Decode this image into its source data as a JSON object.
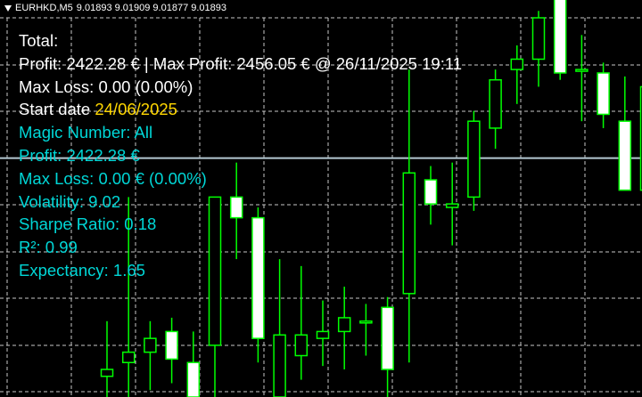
{
  "header": {
    "symbol": "EURHKD,M5",
    "quote": "9.01893 9.01909 9.01877 9.01893"
  },
  "stats": {
    "total_label": "Total:",
    "profit_line": "Profit: 2422.28 € | Max Profit: 2456.05 € @ 26/11/2025 19:11",
    "max_loss_line": "Max Loss: 0.00 (0.00%)",
    "start_label": "Start date",
    "start_value": "24/06/2025",
    "magic_line": "Magic Number: All",
    "magic_profit_line": "Profit: 2422.28 €",
    "magic_max_loss_line": "Max Loss: 0.00 € (0.00%)",
    "volatility_line": "Volatility: 9.02",
    "sharpe_line": "Sharpe Ratio: 0.18",
    "r2_line": "R²: 0.99",
    "expectancy_line": "Expectancy: 1.65"
  },
  "colors": {
    "background": "#000000",
    "grid": "#c8c8c8",
    "bull_body": "#ffffff",
    "bear_body": "#ffffff",
    "wick": "#00ff00",
    "text_primary": "#ffffff",
    "text_secondary": "#00d7d7",
    "text_date": "#ffd700",
    "bid_line": "#b4c8d2"
  },
  "chart_data": {
    "type": "candlestick",
    "symbol": "EURHKD",
    "timeframe": "M5",
    "current_bid": 9.01893,
    "ylim": [
      9.012,
      9.023
    ],
    "candles": [
      {
        "o": 9.0126,
        "h": 9.0142,
        "l": 9.012,
        "c": 9.0128
      },
      {
        "o": 9.013,
        "h": 9.0178,
        "l": 9.012,
        "c": 9.0133
      },
      {
        "o": 9.0133,
        "h": 9.0142,
        "l": 9.0122,
        "c": 9.0137
      },
      {
        "o": 9.0139,
        "h": 9.0143,
        "l": 9.0124,
        "c": 9.0131
      },
      {
        "o": 9.013,
        "h": 9.0139,
        "l": 9.012,
        "c": 9.012
      },
      {
        "o": 9.0135,
        "h": 9.0175,
        "l": 9.012,
        "c": 9.0178
      },
      {
        "o": 9.0178,
        "h": 9.0188,
        "l": 9.016,
        "c": 9.0172
      },
      {
        "o": 9.0172,
        "h": 9.0175,
        "l": 9.013,
        "c": 9.0137
      },
      {
        "o": 9.012,
        "h": 9.016,
        "l": 9.012,
        "c": 9.0138
      },
      {
        "o": 9.0132,
        "h": 9.0158,
        "l": 9.0125,
        "c": 9.0138
      },
      {
        "o": 9.0137,
        "h": 9.0148,
        "l": 9.0129,
        "c": 9.0139
      },
      {
        "o": 9.0139,
        "h": 9.0152,
        "l": 9.0128,
        "c": 9.0143
      },
      {
        "o": 9.0142,
        "h": 9.0147,
        "l": 9.0132,
        "c": 9.0142
      },
      {
        "o": 9.0146,
        "h": 9.0149,
        "l": 9.012,
        "c": 9.0128
      },
      {
        "o": 9.015,
        "h": 9.0215,
        "l": 9.013,
        "c": 9.0185
      },
      {
        "o": 9.0183,
        "h": 9.0187,
        "l": 9.017,
        "c": 9.0176
      },
      {
        "o": 9.0175,
        "h": 9.0188,
        "l": 9.0164,
        "c": 9.0176
      },
      {
        "o": 9.0178,
        "h": 9.0203,
        "l": 9.0174,
        "c": 9.02
      },
      {
        "o": 9.0198,
        "h": 9.0215,
        "l": 9.0192,
        "c": 9.0212
      },
      {
        "o": 9.0215,
        "h": 9.0222,
        "l": 9.0205,
        "c": 9.0218
      },
      {
        "o": 9.0218,
        "h": 9.0232,
        "l": 9.021,
        "c": 9.023
      },
      {
        "o": 9.0236,
        "h": 9.0238,
        "l": 9.0212,
        "c": 9.0214
      },
      {
        "o": 9.0215,
        "h": 9.0225,
        "l": 9.02,
        "c": 9.0215
      },
      {
        "o": 9.0214,
        "h": 9.0217,
        "l": 9.0198,
        "c": 9.0202
      },
      {
        "o": 9.02,
        "h": 9.0213,
        "l": 9.018,
        "c": 9.018
      },
      {
        "o": 9.018,
        "h": 9.022,
        "l": 9.0175,
        "c": 9.021
      }
    ]
  }
}
